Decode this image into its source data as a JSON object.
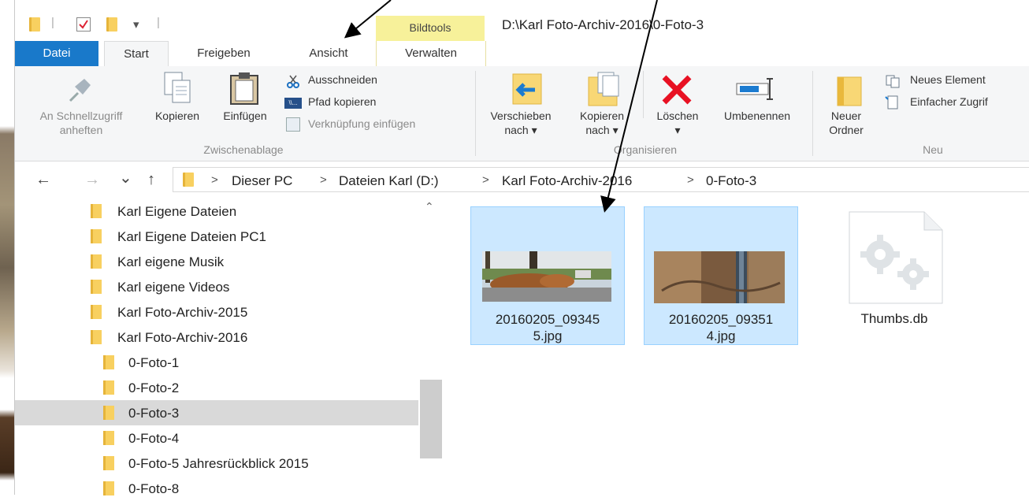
{
  "window_title": "D:\\Karl Foto-Archiv-2016\\0-Foto-3",
  "quick_access": {
    "dropdown_glyph": "▾",
    "divider_glyph": "|"
  },
  "context_tab": {
    "label": "Bildtools",
    "color": "#f7f19a"
  },
  "tabs": [
    "Datei",
    "Start",
    "Freigeben",
    "Ansicht",
    "Verwalten"
  ],
  "ribbon": {
    "pin": {
      "label1": "An Schnellzugriff",
      "label2": "anheften",
      "icon": "pin-icon"
    },
    "copy": {
      "label": "Kopieren",
      "icon": "copy-icon"
    },
    "paste": {
      "label": "Einfügen",
      "icon": "paste-icon"
    },
    "cut": {
      "label": "Ausschneiden",
      "icon": "scissors-icon"
    },
    "copy_path": {
      "label": "Pfad kopieren",
      "icon": "path-icon"
    },
    "paste_shortcut": {
      "label": "Verknüpfung einfügen",
      "icon": "shortcut-icon"
    },
    "group_clipboard": "Zwischenablage",
    "move_to": {
      "label1": "Verschieben",
      "label2": "nach ▾",
      "icon": "move-to-icon"
    },
    "copy_to": {
      "label1": "Kopieren",
      "label2": "nach ▾",
      "icon": "copy-to-icon"
    },
    "delete": {
      "label1": "Löschen",
      "label2": "▾",
      "icon": "delete-x-icon"
    },
    "rename": {
      "label": "Umbenennen",
      "icon": "rename-icon"
    },
    "group_organize": "Organisieren",
    "new_folder": {
      "label1": "Neuer",
      "label2": "Ordner",
      "icon": "new-folder-icon"
    },
    "new_item": {
      "label": "Neues Element",
      "icon": "new-item-icon"
    },
    "easy_access": {
      "label": "Einfacher Zugrif",
      "icon": "easy-access-icon"
    },
    "group_new": "Neu"
  },
  "address": {
    "back": "←",
    "forward": "→",
    "recent": "⌄",
    "up": "↑",
    "breadcrumb": [
      "Dieser PC",
      "Dateien Karl (D:)",
      "Karl Foto-Archiv-2016",
      "0-Foto-3"
    ],
    "separator": ">"
  },
  "nav_pane": {
    "items": [
      {
        "label": "Karl Eigene Dateien",
        "level": 0
      },
      {
        "label": "Karl Eigene Dateien PC1",
        "level": 0
      },
      {
        "label": "Karl eigene Musik",
        "level": 0
      },
      {
        "label": "Karl eigene Videos",
        "level": 0
      },
      {
        "label": "Karl Foto-Archiv-2015",
        "level": 0
      },
      {
        "label": "Karl Foto-Archiv-2016",
        "level": 0
      },
      {
        "label": "0-Foto-1",
        "level": 1
      },
      {
        "label": "0-Foto-2",
        "level": 1
      },
      {
        "label": "0-Foto-3",
        "level": 1,
        "selected": true
      },
      {
        "label": "0-Foto-4",
        "level": 1
      },
      {
        "label": "0-Foto-5 Jahresrückblick 2015",
        "level": 1
      },
      {
        "label": "0-Foto-8",
        "level": 1
      }
    ],
    "scroll_up_glyph": "⌃"
  },
  "files": [
    {
      "line1": "20160205_09345",
      "line2": "5.jpg",
      "selected": true,
      "icon": "photo-thumbnail-icon"
    },
    {
      "line1": "20160205_09351",
      "line2": "4.jpg",
      "selected": true,
      "icon": "photo-thumbnail-icon"
    },
    {
      "line1": "Thumbs.db",
      "line2": "",
      "selected": false,
      "icon": "system-file-gears-icon"
    }
  ],
  "colors": {
    "accent": "#1979ca",
    "selection": "#cce8ff",
    "selection_border": "#99d1ff",
    "delete_red": "#e81123",
    "folder_yellow": "#f8d060"
  }
}
